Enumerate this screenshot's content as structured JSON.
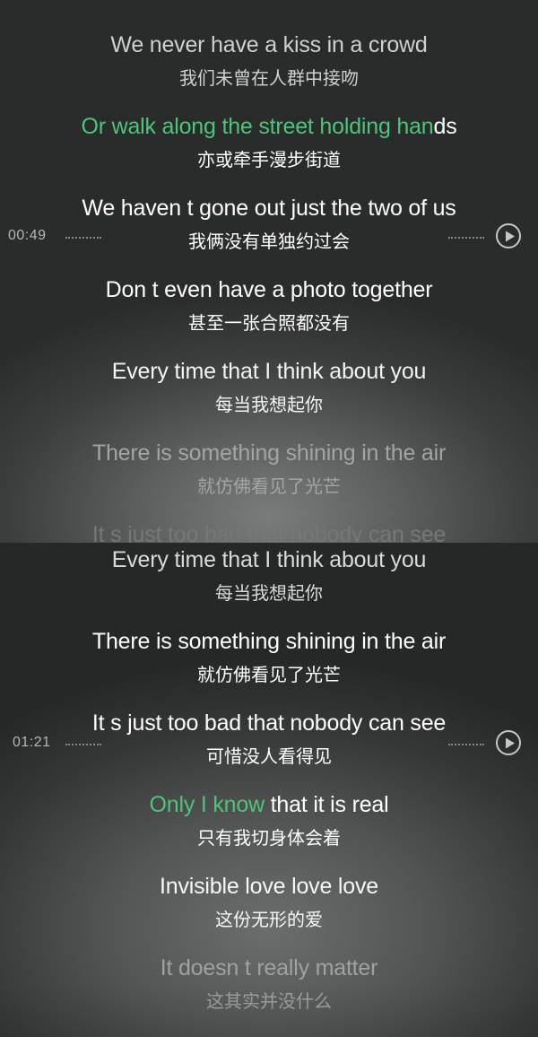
{
  "top": {
    "lines": [
      {
        "en_hl": "",
        "en": "We never have a kiss in a crowd",
        "zh": "我们未曾在人群中接吻"
      },
      {
        "en_hl": "Or walk along the street holding han",
        "en": "ds",
        "zh": "亦或牵手漫步街道"
      },
      {
        "en_hl": "",
        "en": "We haven t gone out just the two of us",
        "zh": "我俩没有单独约过会"
      },
      {
        "en_hl": "",
        "en": "Don t even have a photo together",
        "zh": "甚至一张合照都没有"
      },
      {
        "en_hl": "",
        "en": "Every time that I think about you",
        "zh": "每当我想起你"
      },
      {
        "en_hl": "",
        "en": "There is something shining in the air",
        "zh": "就仿佛看见了光芒"
      },
      {
        "en_hl": "",
        "en": "It s just too bad that nobody can see",
        "zh": ""
      }
    ],
    "timestamp": "00:49"
  },
  "bottom": {
    "lines": [
      {
        "en_hl": "",
        "en": "Every time that I think about you",
        "zh": "每当我想起你"
      },
      {
        "en_hl": "",
        "en": "There is something shining in the air",
        "zh": "就仿佛看见了光芒"
      },
      {
        "en_hl": "",
        "en": "It s just too bad that nobody can see",
        "zh": "可惜没人看得见"
      },
      {
        "en_hl": "Only I know",
        "en": " that it is real",
        "zh": "只有我切身体会着"
      },
      {
        "en_hl": "",
        "en": "Invisible love love love",
        "zh": "这份无形的爱"
      },
      {
        "en_hl": "",
        "en": "It doesn t really matter",
        "zh": "这其实并没什么"
      }
    ],
    "timestamp": "01:21"
  },
  "colors": {
    "highlight": "#4fc37a",
    "text": "#ffffff"
  },
  "icons": {
    "play": "play-circle-icon"
  }
}
